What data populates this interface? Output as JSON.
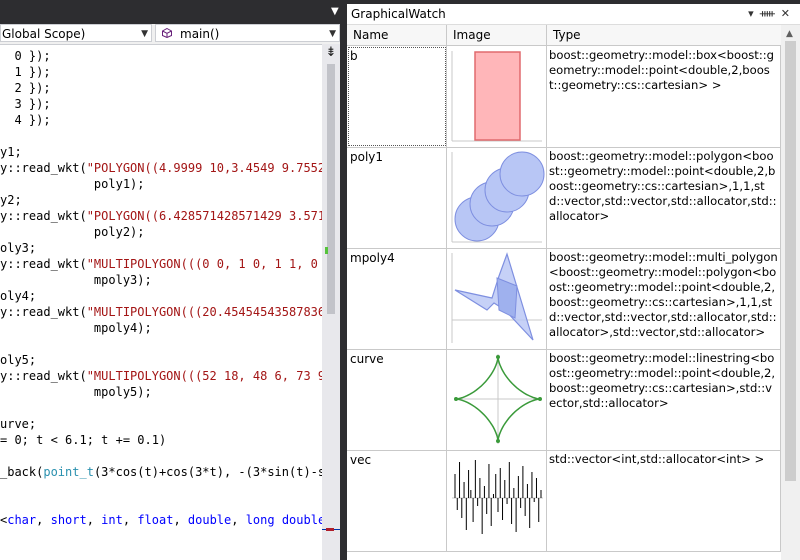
{
  "editor": {
    "scope_dropdown": "Global Scope)",
    "function_dropdown": "main()",
    "lines": [
      [
        {
          "t": "  0 });",
          "c": ""
        }
      ],
      [
        {
          "t": "  1 });",
          "c": ""
        }
      ],
      [
        {
          "t": "  2 });",
          "c": ""
        }
      ],
      [
        {
          "t": "  3 });",
          "c": ""
        }
      ],
      [
        {
          "t": "  4 });",
          "c": ""
        }
      ],
      [
        {
          "t": "",
          "c": ""
        }
      ],
      [
        {
          "t": "y1;",
          "c": ""
        }
      ],
      [
        {
          "t": "y::read_wkt(",
          "c": ""
        },
        {
          "t": "\"POLYGON((4.9999 10,3.4549 9.7552,",
          "c": "str"
        }
      ],
      [
        {
          "t": "             poly1);",
          "c": ""
        }
      ],
      [
        {
          "t": "y2;",
          "c": ""
        }
      ],
      [
        {
          "t": "y::read_wkt(",
          "c": ""
        },
        {
          "t": "\"POLYGON((6.428571428571429 3.5714",
          "c": "str"
        }
      ],
      [
        {
          "t": "             poly2);",
          "c": ""
        }
      ],
      [
        {
          "t": "oly3;",
          "c": ""
        }
      ],
      [
        {
          "t": "y::read_wkt(",
          "c": ""
        },
        {
          "t": "\"MULTIPOLYGON(((0 0, 1 0, 1 1, 0 1",
          "c": "str"
        }
      ],
      [
        {
          "t": "             mpoly3);",
          "c": ""
        }
      ],
      [
        {
          "t": "oly4;",
          "c": ""
        }
      ],
      [
        {
          "t": "y::read_wkt(",
          "c": ""
        },
        {
          "t": "\"MULTIPOLYGON(((20.454545435878362",
          "c": "str"
        }
      ],
      [
        {
          "t": "             mpoly4);",
          "c": ""
        }
      ],
      [
        {
          "t": "",
          "c": ""
        }
      ],
      [
        {
          "t": "oly5;",
          "c": ""
        }
      ],
      [
        {
          "t": "y::read_wkt(",
          "c": ""
        },
        {
          "t": "\"MULTIPOLYGON(((52 18, 48 6, 73 9,",
          "c": "str"
        }
      ],
      [
        {
          "t": "             mpoly5);",
          "c": ""
        }
      ],
      [
        {
          "t": "",
          "c": ""
        }
      ],
      [
        {
          "t": "urve;",
          "c": ""
        }
      ],
      [
        {
          "t": "= 0; t < 6.1; t += 0.1)",
          "c": ""
        }
      ],
      [
        {
          "t": "",
          "c": ""
        }
      ],
      [
        {
          "t": "_back(",
          "c": ""
        },
        {
          "t": "point_t",
          "c": "ty"
        },
        {
          "t": "(3*cos(t)+cos(3*t), -(3*sin(t)-si",
          "c": ""
        }
      ],
      [
        {
          "t": "",
          "c": ""
        }
      ],
      [
        {
          "t": "",
          "c": ""
        }
      ],
      [
        {
          "t": "<",
          "c": ""
        },
        {
          "t": "char",
          "c": "kw"
        },
        {
          "t": ", ",
          "c": ""
        },
        {
          "t": "short",
          "c": "kw"
        },
        {
          "t": ", ",
          "c": ""
        },
        {
          "t": "int",
          "c": "kw"
        },
        {
          "t": ", ",
          "c": ""
        },
        {
          "t": "float",
          "c": "kw"
        },
        {
          "t": ", ",
          "c": ""
        },
        {
          "t": "double",
          "c": "kw"
        },
        {
          "t": ", ",
          "c": ""
        },
        {
          "t": "long double",
          "c": "kw"
        },
        {
          "t": ",",
          "c": ""
        }
      ]
    ]
  },
  "panel": {
    "title": "GraphicalWatch",
    "title_buttons": "▾ ⊥ ✕",
    "columns": {
      "name": "Name",
      "image": "Image",
      "type": "Type"
    },
    "rows": [
      {
        "name": "b",
        "kind": "box",
        "type": "boost::geometry::model::box<boost::geometry::model::point<double,2,boost::geometry::cs::cartesian> >"
      },
      {
        "name": "poly1",
        "kind": "poly",
        "type": "boost::geometry::model::polygon<boost::geometry::model::point<double,2,boost::geometry::cs::cartesian>,1,1,std::vector,std::vector,std::allocator,std::allocator>"
      },
      {
        "name": "mpoly4",
        "kind": "mpoly",
        "type": "boost::geometry::model::multi_polygon<boost::geometry::model::polygon<boost::geometry::model::point<double,2,boost::geometry::cs::cartesian>,1,1,std::vector,std::vector,std::allocator,std::allocator>,std::vector,std::allocator>"
      },
      {
        "name": "curve",
        "kind": "curve",
        "type": "boost::geometry::model::linestring<boost::geometry::model::point<double,2,boost::geometry::cs::cartesian>,std::vector,std::allocator>"
      },
      {
        "name": "vec",
        "kind": "vec",
        "type": "std::vector<int,std::allocator<int> >",
        "values": [
          0.6,
          -0.3,
          0.9,
          -0.5,
          0.4,
          -0.8,
          0.7,
          0.2,
          -0.6,
          0.95,
          -0.2,
          0.5,
          -0.9,
          0.3,
          -0.4,
          0.85,
          -0.7,
          0.1,
          0.6,
          -0.35,
          0.75,
          -0.55,
          0.45,
          -0.15,
          0.9,
          -0.65,
          0.25,
          -0.85,
          0.55,
          -0.25,
          0.8,
          -0.45,
          0.35,
          -0.75,
          0.65,
          -0.1,
          0.5,
          -0.6,
          0.2
        ]
      }
    ],
    "colors": {
      "box_fill": "#ffb6b9",
      "box_stroke": "#e06a6e",
      "poly_fill": "#b8c6f5",
      "poly_stroke": "#7e8fe0",
      "curve_stroke": "#3a9a3a",
      "vec_stroke": "#000000"
    }
  }
}
